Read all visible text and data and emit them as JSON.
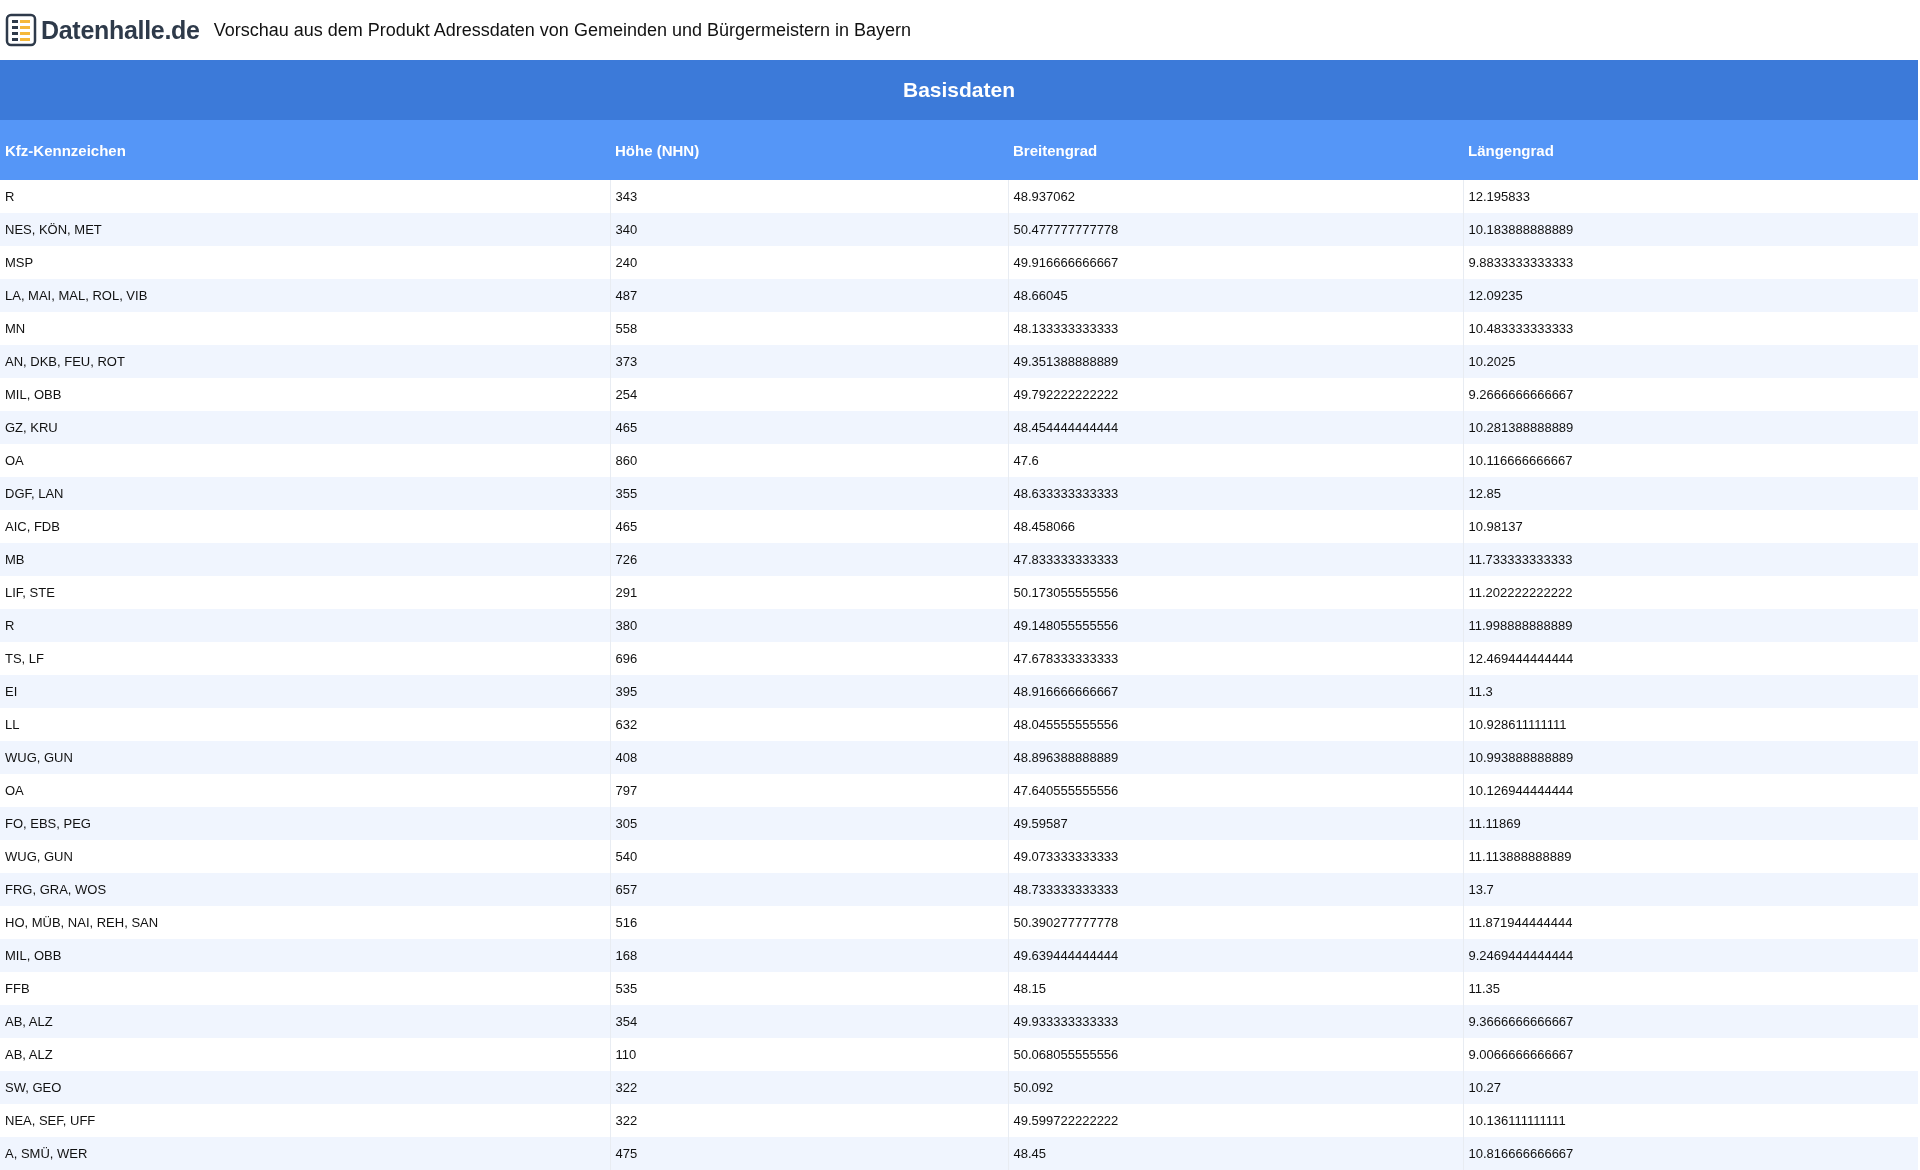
{
  "header": {
    "logo_text": "Datenhalle.de",
    "title": "Vorschau aus dem Produkt Adressdaten von Gemeinden und Bürgermeistern in Bayern"
  },
  "section_title": "Basisdaten",
  "table": {
    "columns": [
      "Kfz-Kennzeichen",
      "Höhe (NHN)",
      "Breitengrad",
      "Längengrad"
    ],
    "rows": [
      [
        "R",
        "343",
        "48.937062",
        "12.195833"
      ],
      [
        "NES, KÖN, MET",
        "340",
        "50.477777777778",
        "10.183888888889"
      ],
      [
        "MSP",
        "240",
        "49.916666666667",
        "9.8833333333333"
      ],
      [
        "LA, MAI, MAL, ROL, VIB",
        "487",
        "48.66045",
        "12.09235"
      ],
      [
        "MN",
        "558",
        "48.133333333333",
        "10.483333333333"
      ],
      [
        "AN, DKB, FEU, ROT",
        "373",
        "49.351388888889",
        "10.2025"
      ],
      [
        "MIL, OBB",
        "254",
        "49.792222222222",
        "9.2666666666667"
      ],
      [
        "GZ, KRU",
        "465",
        "48.454444444444",
        "10.281388888889"
      ],
      [
        "OA",
        "860",
        "47.6",
        "10.116666666667"
      ],
      [
        "DGF, LAN",
        "355",
        "48.633333333333",
        "12.85"
      ],
      [
        "AIC, FDB",
        "465",
        "48.458066",
        "10.98137"
      ],
      [
        "MB",
        "726",
        "47.833333333333",
        "11.733333333333"
      ],
      [
        "LIF, STE",
        "291",
        "50.173055555556",
        "11.202222222222"
      ],
      [
        "R",
        "380",
        "49.148055555556",
        "11.998888888889"
      ],
      [
        "TS, LF",
        "696",
        "47.678333333333",
        "12.469444444444"
      ],
      [
        "EI",
        "395",
        "48.916666666667",
        "11.3"
      ],
      [
        "LL",
        "632",
        "48.045555555556",
        "10.928611111111"
      ],
      [
        "WUG, GUN",
        "408",
        "48.896388888889",
        "10.993888888889"
      ],
      [
        "OA",
        "797",
        "47.640555555556",
        "10.126944444444"
      ],
      [
        "FO, EBS, PEG",
        "305",
        "49.59587",
        "11.11869"
      ],
      [
        "WUG, GUN",
        "540",
        "49.073333333333",
        "11.113888888889"
      ],
      [
        "FRG, GRA, WOS",
        "657",
        "48.733333333333",
        "13.7"
      ],
      [
        "HO, MÜB, NAI, REH, SAN",
        "516",
        "50.390277777778",
        "11.871944444444"
      ],
      [
        "MIL, OBB",
        "168",
        "49.639444444444",
        "9.2469444444444"
      ],
      [
        "FFB",
        "535",
        "48.15",
        "11.35"
      ],
      [
        "AB, ALZ",
        "354",
        "49.933333333333",
        "9.3666666666667"
      ],
      [
        "AB, ALZ",
        "110",
        "50.068055555556",
        "9.0066666666667"
      ],
      [
        "SW, GEO",
        "322",
        "50.092",
        "10.27"
      ],
      [
        "NEA, SEF, UFF",
        "322",
        "49.599722222222",
        "10.136111111111"
      ],
      [
        "A, SMÜ, WER",
        "475",
        "48.45",
        "10.816666666667"
      ]
    ]
  }
}
